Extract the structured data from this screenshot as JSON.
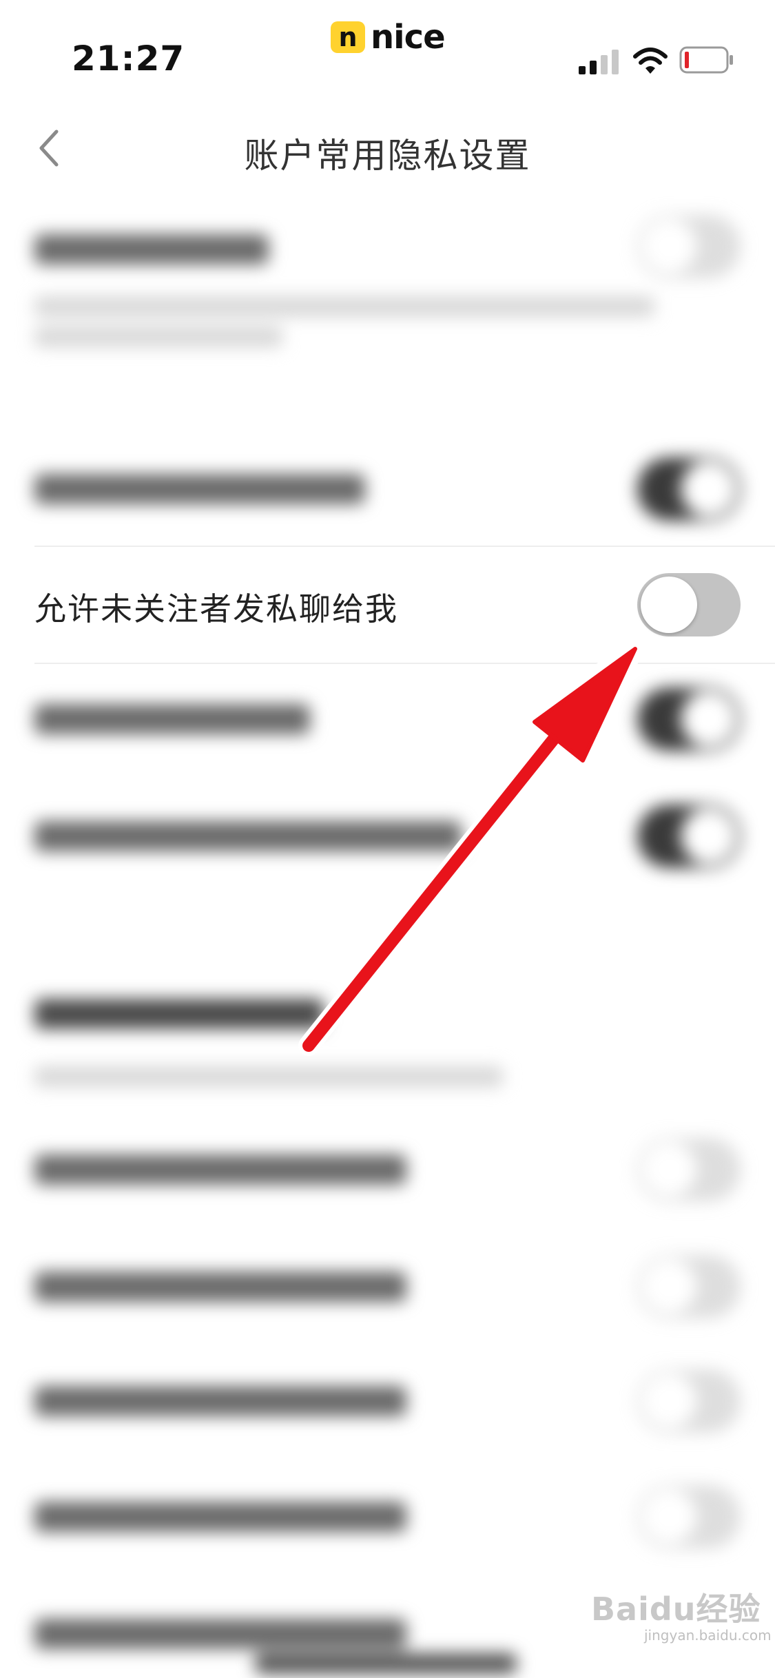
{
  "status_bar": {
    "time": "21:27",
    "app_logo_badge": "n",
    "app_logo_name": "nice"
  },
  "nav": {
    "title": "账户常用隐私设置",
    "back_icon": "chevron-left-icon"
  },
  "focused_setting": {
    "label": "允许未关注者发私聊给我",
    "toggle_state": "off"
  },
  "colors": {
    "arrow": "#e8131b",
    "toggle_off": "#c3c3c3",
    "toggle_on": "#3a3a3a",
    "logo_badge": "#ffd22e"
  },
  "watermark": {
    "text": "Baidu经验",
    "sub": "jingyan.baidu.com"
  }
}
